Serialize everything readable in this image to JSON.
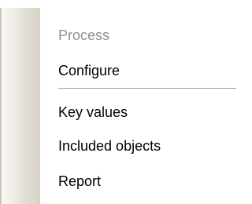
{
  "menu": {
    "items": [
      {
        "label": "Process",
        "disabled": true
      },
      {
        "label": "Configure",
        "disabled": false
      },
      {
        "label": "Key values",
        "disabled": false
      },
      {
        "label": "Included objects",
        "disabled": false
      },
      {
        "label": "Report",
        "disabled": false
      }
    ]
  }
}
